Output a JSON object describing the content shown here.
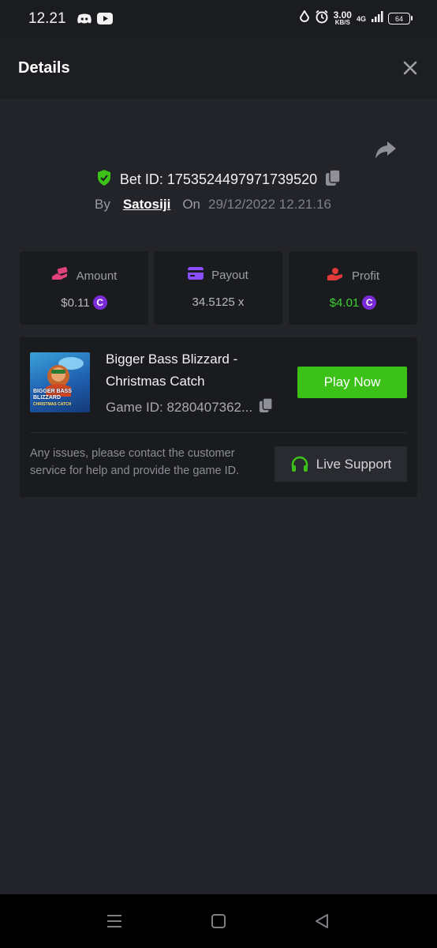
{
  "status_bar": {
    "time": "12.21",
    "speed_value": "3.00",
    "speed_unit": "KB/S",
    "network": "4G",
    "battery": "64",
    "icons": [
      "discord-icon",
      "youtube-icon",
      "data-saver-icon",
      "alarm-icon",
      "signal-icon",
      "battery-icon"
    ]
  },
  "header": {
    "title": "Details"
  },
  "bet": {
    "id_text": "Bet ID: 1753524497971739520",
    "by_label": "By",
    "user": "Satosiji",
    "on_label": "On",
    "date": "29/12/2022 12.21.16"
  },
  "stats": [
    {
      "label": "Amount",
      "value": "$0.11",
      "icon": "money-hand-icon",
      "icon_color": "#e0427a",
      "has_coin": true
    },
    {
      "label": "Payout",
      "value": "34.5125 x",
      "icon": "card-icon",
      "icon_color": "#8a4dff",
      "has_coin": false
    },
    {
      "label": "Profit",
      "value": "$4.01",
      "icon": "profit-hand-icon",
      "icon_color": "#e03a3a",
      "has_coin": true,
      "value_color": "#3fd234"
    }
  ],
  "coin_symbol": "C",
  "game": {
    "title": "Bigger Bass Blizzard - Christmas Catch",
    "thumb_title": "BIGGER BASS BLIZZARD",
    "thumb_sub": "CHRISTMAS CATCH",
    "game_id": "Game ID: 8280407362...",
    "play_label": "Play Now",
    "support_text": "Any issues, please contact the customer service for help and provide the game ID.",
    "support_label": "Live Support"
  },
  "colors": {
    "accent_green": "#3bc117",
    "background": "#232429",
    "card": "#1a1b1f",
    "coin_purple": "#7b2bd8"
  }
}
